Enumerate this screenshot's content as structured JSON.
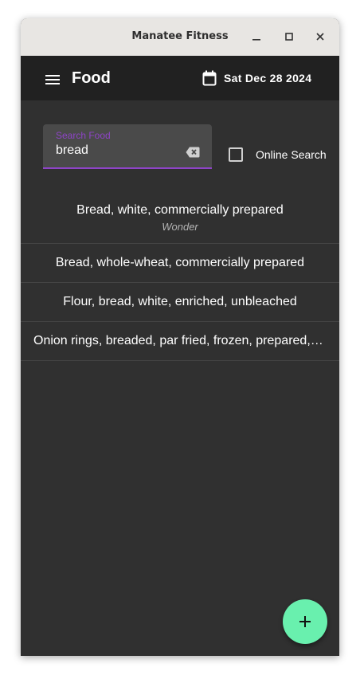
{
  "window": {
    "title": "Manatee Fitness"
  },
  "appbar": {
    "title": "Food",
    "date": "Sat Dec 28 2024",
    "menu_icon": "hamburger-menu-icon",
    "date_icon": "calendar-icon"
  },
  "search": {
    "label": "Search Food",
    "value": "bread",
    "clear_icon": "backspace-clear-icon",
    "online_search_label": "Online Search",
    "online_search_checked": false
  },
  "foods": [
    {
      "name": "Bread, white, commercially prepared",
      "brand": "Wonder"
    },
    {
      "name": "Bread, whole-wheat, commercially prepared"
    },
    {
      "name": "Flour, bread, white, enriched, unbleached"
    },
    {
      "name": "Onion rings, breaded, par fried, frozen, prepared, heated in oven"
    }
  ],
  "fab": {
    "icon": "plus-icon"
  },
  "colors": {
    "accent": "#8e44c7",
    "fab": "#69f0ae",
    "appbar": "#212121",
    "background": "#303030"
  }
}
